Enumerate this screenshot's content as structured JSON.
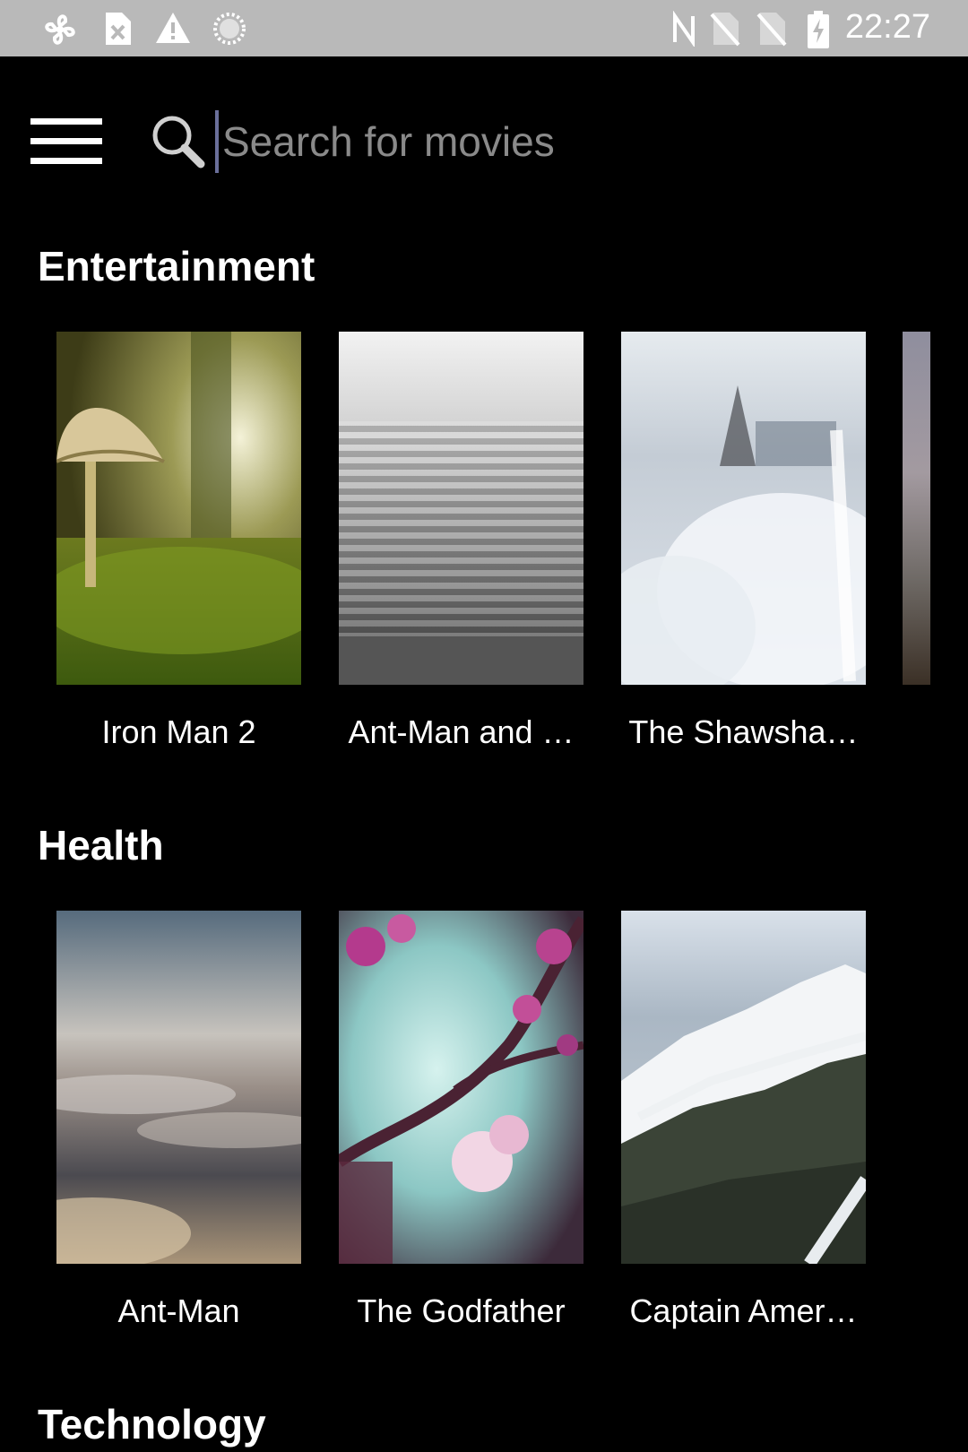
{
  "status_bar": {
    "time": "22:27",
    "icons": [
      "fan-icon",
      "sim-error-icon",
      "warning-icon",
      "sync-circle-icon",
      "nfc-icon",
      "no-sim-icon",
      "no-sim-icon",
      "battery-charging-icon"
    ]
  },
  "toolbar": {
    "menu_icon": "hamburger-menu-icon",
    "search_icon": "search-icon",
    "search_placeholder": "Search for movies",
    "search_value": ""
  },
  "sections": [
    {
      "title": "Entertainment",
      "items": [
        {
          "title": "Iron Man 2",
          "image": "mushroom-moss"
        },
        {
          "title": "Ant-Man and …",
          "image": "foggy-stairs"
        },
        {
          "title": "The Shawsha…",
          "image": "frosted-plants"
        }
      ]
    },
    {
      "title": "Health",
      "items": [
        {
          "title": "Ant-Man",
          "image": "clouds-sky"
        },
        {
          "title": "The Godfather",
          "image": "pink-blossoms"
        },
        {
          "title": "Captain Amer…",
          "image": "snowy-mountain"
        }
      ]
    },
    {
      "title": "Technology",
      "items": []
    }
  ],
  "colors": {
    "background": "#000000",
    "status_bar": "#b9b9b9",
    "text": "#ffffff",
    "placeholder": "#8a8a8a",
    "cursor": "#6a6f9a"
  }
}
